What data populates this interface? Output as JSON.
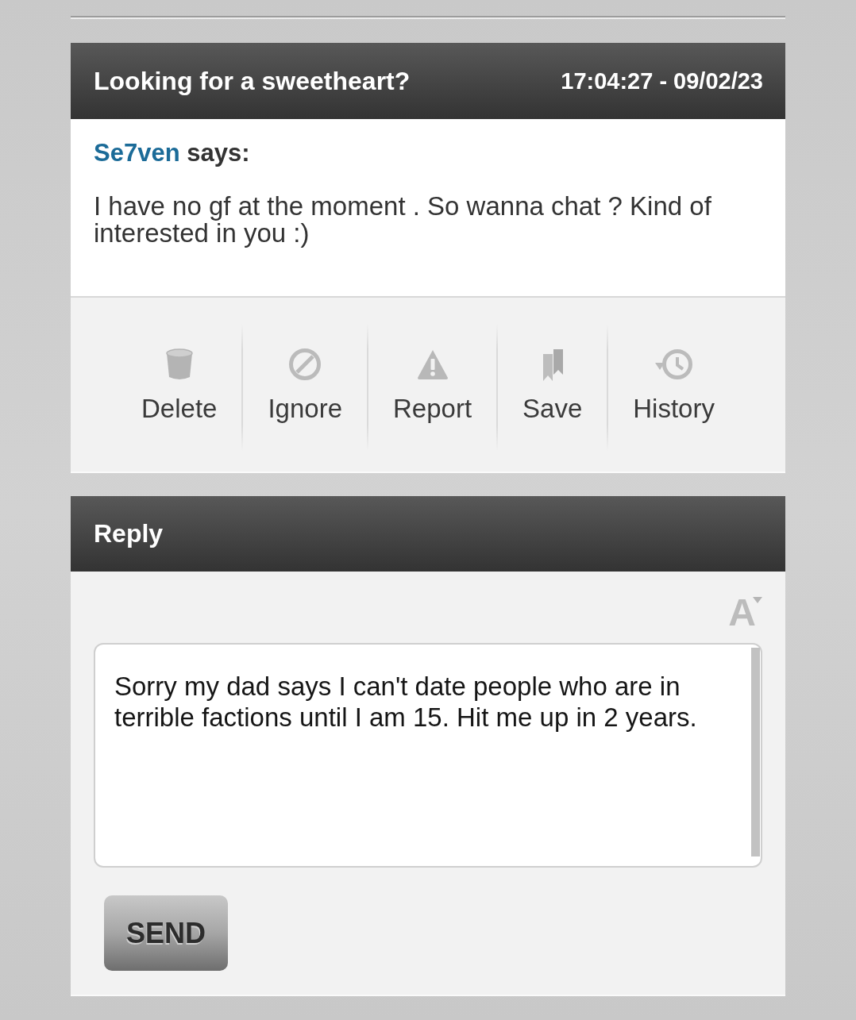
{
  "message": {
    "title": "Looking for a sweetheart?",
    "timestamp": "17:04:27 - 09/02/23",
    "author": "Se7ven",
    "says": "says:",
    "body": "I have no gf at the moment . So wanna chat ? Kind of interested in you :)"
  },
  "actions": [
    {
      "kind": "delete",
      "label": "Delete"
    },
    {
      "kind": "ignore",
      "label": "Ignore"
    },
    {
      "kind": "report",
      "label": "Report"
    },
    {
      "kind": "save",
      "label": "Save"
    },
    {
      "kind": "history",
      "label": "History"
    }
  ],
  "reply": {
    "title": "Reply",
    "text_size": "A",
    "value": "Sorry my dad says I can't date people who are in terrible factions until I am 15. Hit me up in 2 years.",
    "send": "SEND"
  }
}
